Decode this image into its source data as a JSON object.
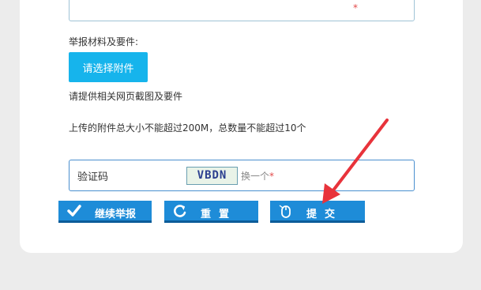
{
  "form": {
    "required_mark": "*",
    "materials_label": "举报材料及要件:",
    "attach_button": "请选择附件",
    "hint_screenshot": "请提供相关网页截图及要件",
    "hint_limits": "上传的附件总大小不能超过200M，总数量不能超过10个",
    "captcha_label": "验证码",
    "captcha_code": "VBDN",
    "captcha_refresh": "换一个",
    "captcha_required": "*"
  },
  "actions": {
    "continue_label": "继续举报",
    "reset_label": "重置",
    "submit_label": "提交"
  },
  "colors": {
    "primary": "#1e8cd8",
    "attach": "#16b4ec",
    "annotation_arrow": "#e8333b"
  },
  "icons": [
    "check-icon",
    "refresh-icon",
    "mouse-icon"
  ]
}
